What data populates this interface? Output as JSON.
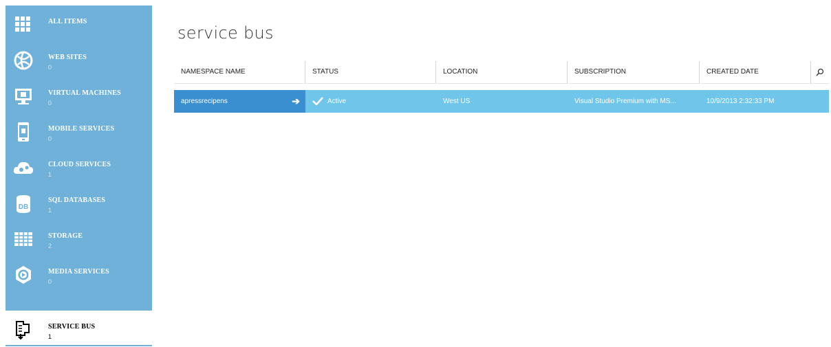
{
  "sidebar": {
    "items": [
      {
        "label": "ALL ITEMS",
        "count": "",
        "icon": "grid-icon"
      },
      {
        "label": "WEB SITES",
        "count": "0",
        "icon": "globe-icon"
      },
      {
        "label": "VIRTUAL MACHINES",
        "count": "0",
        "icon": "monitor-icon"
      },
      {
        "label": "MOBILE SERVICES",
        "count": "0",
        "icon": "phone-icon"
      },
      {
        "label": "CLOUD SERVICES",
        "count": "1",
        "icon": "cloud-gears-icon"
      },
      {
        "label": "SQL DATABASES",
        "count": "1",
        "icon": "database-icon"
      },
      {
        "label": "STORAGE",
        "count": "2",
        "icon": "table-icon"
      },
      {
        "label": "MEDIA SERVICES",
        "count": "0",
        "icon": "play-circle-icon"
      },
      {
        "label": "SERVICE BUS",
        "count": "1",
        "icon": "service-bus-icon"
      }
    ],
    "active_index": 8
  },
  "page": {
    "title": "service bus"
  },
  "table": {
    "columns": [
      "NAMESPACE NAME",
      "STATUS",
      "LOCATION",
      "SUBSCRIPTION",
      "CREATED DATE"
    ],
    "rows": [
      {
        "name": "apressrecipens",
        "status": "Active",
        "location": "West US",
        "subscription": "Visual Studio Premium with MS...",
        "created": "10/9/2013 2:32:33 PM"
      }
    ]
  },
  "colors": {
    "sidebar": "#6fb1d8",
    "selected_row": "#6fc6ea",
    "selected_name_cell": "#3a8fd0"
  }
}
